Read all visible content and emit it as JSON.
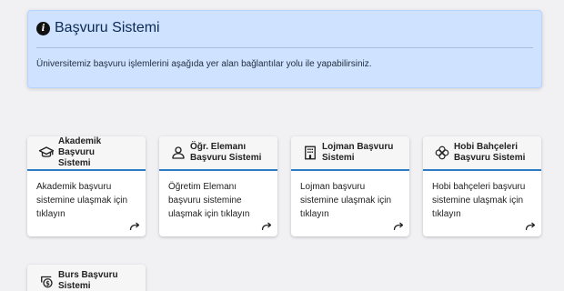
{
  "info": {
    "title": "Başvuru Sistemi",
    "text": "Üniversitemiz başvuru işlemlerini aşağıda yer alan bağlantılar yolu ile yapabilirsiniz."
  },
  "cards": [
    {
      "title_line1": "Akademik Başvuru",
      "title_line2": "Sistemi",
      "body": "Akademik başvuru sistemine ulaşmak için tıklayın",
      "icon": "graduation-cap-icon"
    },
    {
      "title_line1": "Öğr. Elemanı",
      "title_line2": "Başvuru Sistemi",
      "body": "Öğretim Elemanı başvuru sistemine ulaşmak için tıklayın",
      "icon": "person-icon"
    },
    {
      "title_line1": "Lojman Başvuru",
      "title_line2": "Sistemi",
      "body": "Lojman başvuru sistemine ulaşmak için tıklayın",
      "icon": "building-icon"
    },
    {
      "title_line1": "Hobi Bahçeleri",
      "title_line2": "Başvuru Sistemi",
      "body": "Hobi bahçeleri başvuru sistemine ulaşmak için tıklayın",
      "icon": "flower-icon"
    },
    {
      "title_line1": "Burs Başvuru",
      "title_line2": "Sistemi",
      "body": "",
      "icon": "money-icon"
    }
  ]
}
